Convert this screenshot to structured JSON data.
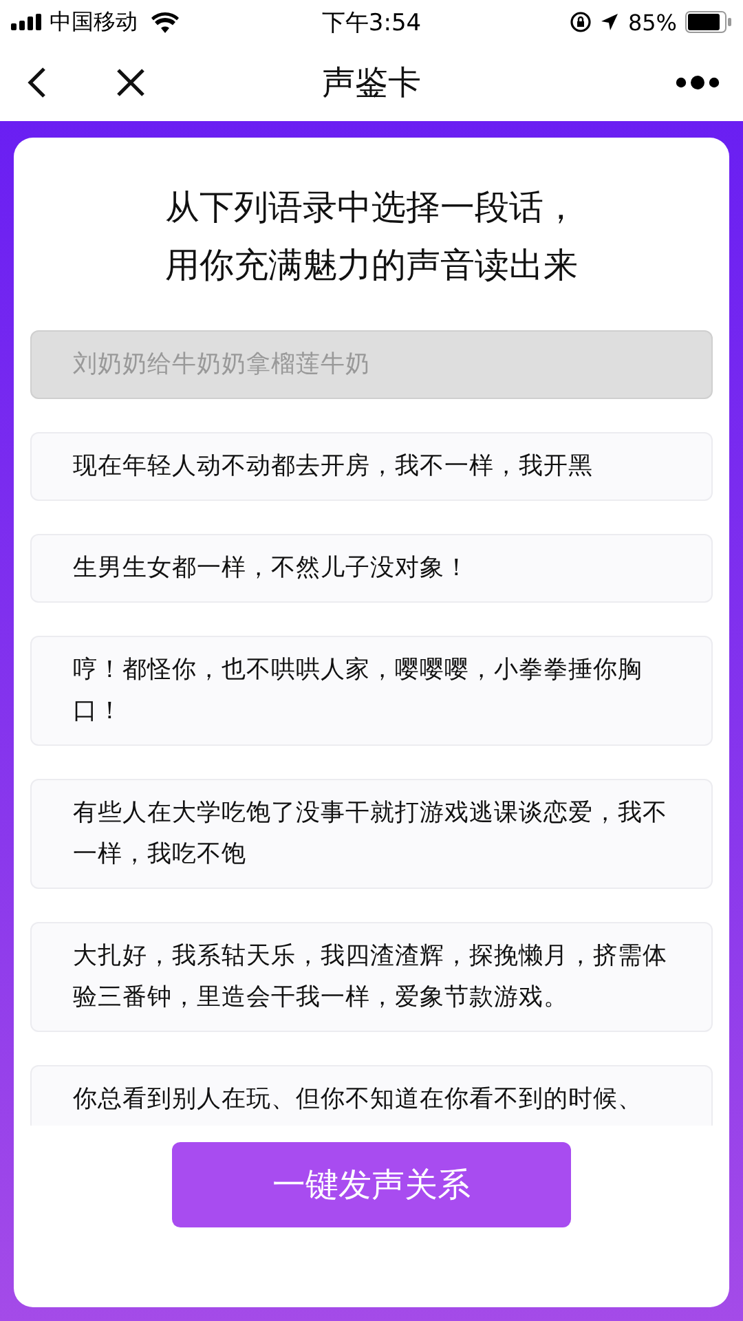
{
  "status_bar": {
    "carrier": "中国移动",
    "time": "下午3:54",
    "battery": "85%"
  },
  "nav": {
    "title": "声鉴卡"
  },
  "heading": [
    "从下列语录中选择一段话，",
    "用你充满魅力的声音读出来"
  ],
  "options": [
    {
      "text": "刘奶奶给牛奶奶拿榴莲牛奶",
      "selected": true
    },
    {
      "text": "现在年轻人动不动都去开房，我不一样，我开黑",
      "selected": false
    },
    {
      "text": "生男生女都一样，不然儿子没对象！",
      "selected": false
    },
    {
      "text": "哼！都怪你，也不哄哄人家，嘤嘤嘤，小拳拳捶你胸口！",
      "selected": false
    },
    {
      "text": "有些人在大学吃饱了没事干就打游戏逃课谈恋爱，我不一样，我吃不饱",
      "selected": false
    },
    {
      "text": "大扎好，我系轱天乐，我四渣渣辉，探挽懒月，挤需体验三番钟，里造会干我一样，爱象节款游戏。",
      "selected": false
    },
    {
      "text": "你总看到别人在玩、但你不知道在你看不到的时候、",
      "selected": false
    }
  ],
  "button": {
    "label": "一键发声关系"
  }
}
